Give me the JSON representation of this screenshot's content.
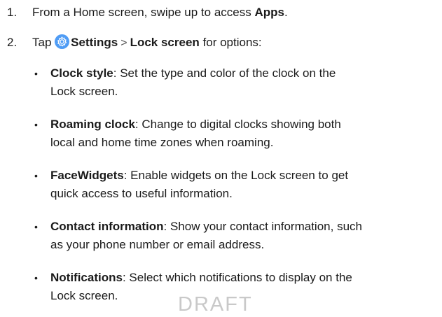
{
  "steps": [
    {
      "number": "1.",
      "prefix": "From a Home screen, swipe up to access ",
      "bold": "Apps",
      "suffix": "."
    },
    {
      "number": "2.",
      "prefix": "Tap",
      "icon": "settings-gear-icon",
      "settings_label": "Settings",
      "separator": ">",
      "lock_label": "Lock screen",
      "suffix": " for options:"
    }
  ],
  "options": [
    {
      "term": "Clock style",
      "line1": ": Set the type and color of the clock on the",
      "line2": "Lock screen."
    },
    {
      "term": "Roaming clock",
      "line1": ": Change to digital clocks showing both",
      "line2": "local and home time zones when roaming."
    },
    {
      "term": "FaceWidgets",
      "line1": ": Enable widgets on the Lock screen to get",
      "line2": "quick access to useful information."
    },
    {
      "term": "Contact information",
      "line1": ": Show your contact information, such",
      "line2": "as your phone number or email address."
    },
    {
      "term": "Notifications",
      "line1": ": Select which notifications to display on the",
      "line2": "Lock screen."
    }
  ],
  "bullet_char": "•",
  "watermark": "DRAFT",
  "colors": {
    "text": "#1a1a1a",
    "settings_icon_bg": "#4f9cf5",
    "watermark": "#c9c9c9"
  }
}
